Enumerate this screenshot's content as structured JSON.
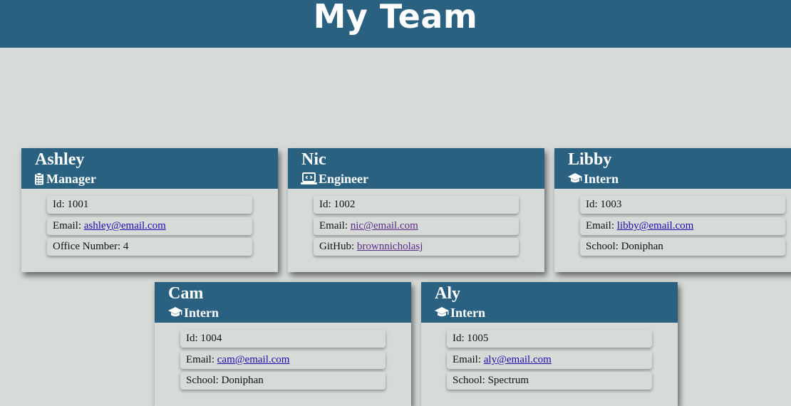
{
  "header": {
    "title": "My Team"
  },
  "team": [
    {
      "name": "Ashley",
      "role": "Manager",
      "role_icon": "clipboard-icon",
      "id_label": "Id: 1001",
      "email_prefix": "Email: ",
      "email": "ashley@email.com",
      "extra_prefix": "Office Number: 4",
      "extra_link": ""
    },
    {
      "name": "Nic",
      "role": "Engineer",
      "role_icon": "laptop-code-icon",
      "id_label": "Id: 1002",
      "email_prefix": "Email: ",
      "email": "nic@email.com",
      "extra_prefix": "GitHub: ",
      "extra_link": "brownnicholasj"
    },
    {
      "name": "Libby",
      "role": "Intern",
      "role_icon": "graduation-cap-icon",
      "id_label": "Id: 1003",
      "email_prefix": "Email: ",
      "email": "libby@email.com",
      "extra_prefix": "School: Doniphan",
      "extra_link": ""
    },
    {
      "name": "Cam",
      "role": "Intern",
      "role_icon": "graduation-cap-icon",
      "id_label": "Id: 1004",
      "email_prefix": "Email: ",
      "email": "cam@email.com",
      "extra_prefix": "School: Doniphan",
      "extra_link": ""
    },
    {
      "name": "Aly",
      "role": "Intern",
      "role_icon": "graduation-cap-icon",
      "id_label": "Id: 1005",
      "email_prefix": "Email: ",
      "email": "aly@email.com",
      "extra_prefix": "School: Spectrum",
      "extra_link": ""
    }
  ],
  "colors": {
    "header_bg": "#2b6180",
    "page_bg": "#d7dbd8",
    "link": "#1a0dab",
    "link_visited": "#5b2a86"
  }
}
